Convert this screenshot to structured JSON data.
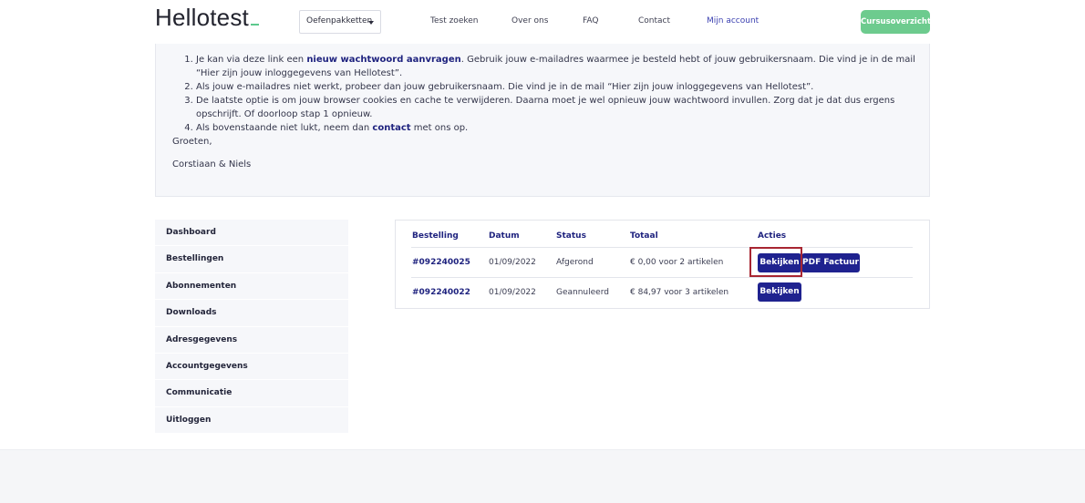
{
  "header": {
    "logo": "Hellotest",
    "select_value": "Oefenpakketten",
    "nav": [
      "Test zoeken",
      "Over ons",
      "FAQ",
      "Contact",
      "Mijn account"
    ],
    "course_button": "Cursusoverzicht",
    "accent_color": "#6dcb8e"
  },
  "info": {
    "steps": [
      {
        "pre": "Je kan via deze link een ",
        "link": "nieuw wachtwoord aanvragen",
        "post": ". Gebruik jouw e-mailadres waarmee je besteld hebt of jouw gebruikersnaam. Die vind je in de mail “Hier zijn jouw inloggegevens van Hellotest”."
      },
      {
        "pre": "Als jouw e-mailadres niet werkt, probeer dan jouw gebruikersnaam. Die vind je in de mail “Hier zijn jouw inloggegevens van Hellotest”.",
        "link": "",
        "post": ""
      },
      {
        "pre": "De laatste optie is om jouw browser cookies en cache te verwijderen. Daarna moet je wel opnieuw jouw wachtwoord invullen. Zorg dat je dat dus ergens opschrijft. Of doorloop stap 1 opnieuw.",
        "link": "",
        "post": ""
      },
      {
        "pre": "Als bovenstaande niet lukt, neem dan ",
        "link": "contact",
        "post": " met ons op."
      }
    ],
    "greeting": "Groeten,",
    "signature": "Corstiaan & Niels"
  },
  "sidebar": {
    "items": [
      "Dashboard",
      "Bestellingen",
      "Abonnementen",
      "Downloads",
      "Adresgegevens",
      "Accountgegevens",
      "Communicatie",
      "Uitloggen"
    ]
  },
  "orders": {
    "headers": [
      "Bestelling",
      "Datum",
      "Status",
      "Totaal",
      "Acties"
    ],
    "rows": [
      {
        "id": "#092240025",
        "date": "01/09/2022",
        "status": "Afgerond",
        "total": "€ 0,00 voor 2 artikelen",
        "view": "Bekijken",
        "invoice": "PDF Factuur"
      },
      {
        "id": "#092240022",
        "date": "01/09/2022",
        "status": "Geannuleerd",
        "total": "€ 84,97 voor 3 artikelen",
        "view": "Bekijken"
      }
    ],
    "button_color": "#1f228f"
  }
}
